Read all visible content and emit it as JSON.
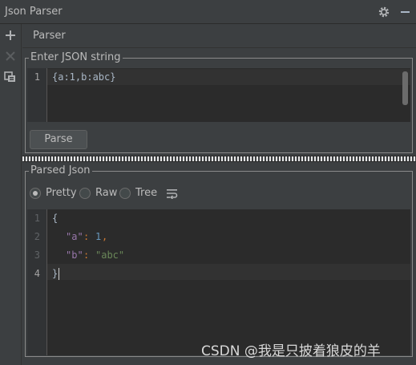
{
  "window": {
    "title": "Json Parser"
  },
  "toolbar": {
    "icons": [
      "plus-icon",
      "close-icon",
      "copy-icon"
    ]
  },
  "tab": {
    "label": "Parser"
  },
  "input_group": {
    "legend": "Enter JSON string",
    "line_number": "1",
    "text": "{a:1,b:abc}",
    "parse_button": "Parse"
  },
  "output_group": {
    "legend": "Parsed Json",
    "modes": {
      "pretty": "Pretty",
      "raw": "Raw",
      "tree": "Tree"
    },
    "selected_mode": "Pretty",
    "line_numbers": [
      "1",
      "2",
      "3",
      "4"
    ],
    "lines": {
      "l1": "{",
      "l2_key": "\"a\"",
      "l2_colon": ": ",
      "l2_value": "1",
      "l2_comma": ",",
      "l3_key": "\"b\"",
      "l3_colon": ": ",
      "l3_value": "\"abc\"",
      "l4": "}"
    }
  },
  "colors": {
    "background": "#3c3f41",
    "editor": "#2b2b2b",
    "json_key": "#9876aa",
    "json_number": "#6897bb",
    "json_string": "#6a8759"
  },
  "watermark": "CSDN @我是只披着狼皮的羊"
}
